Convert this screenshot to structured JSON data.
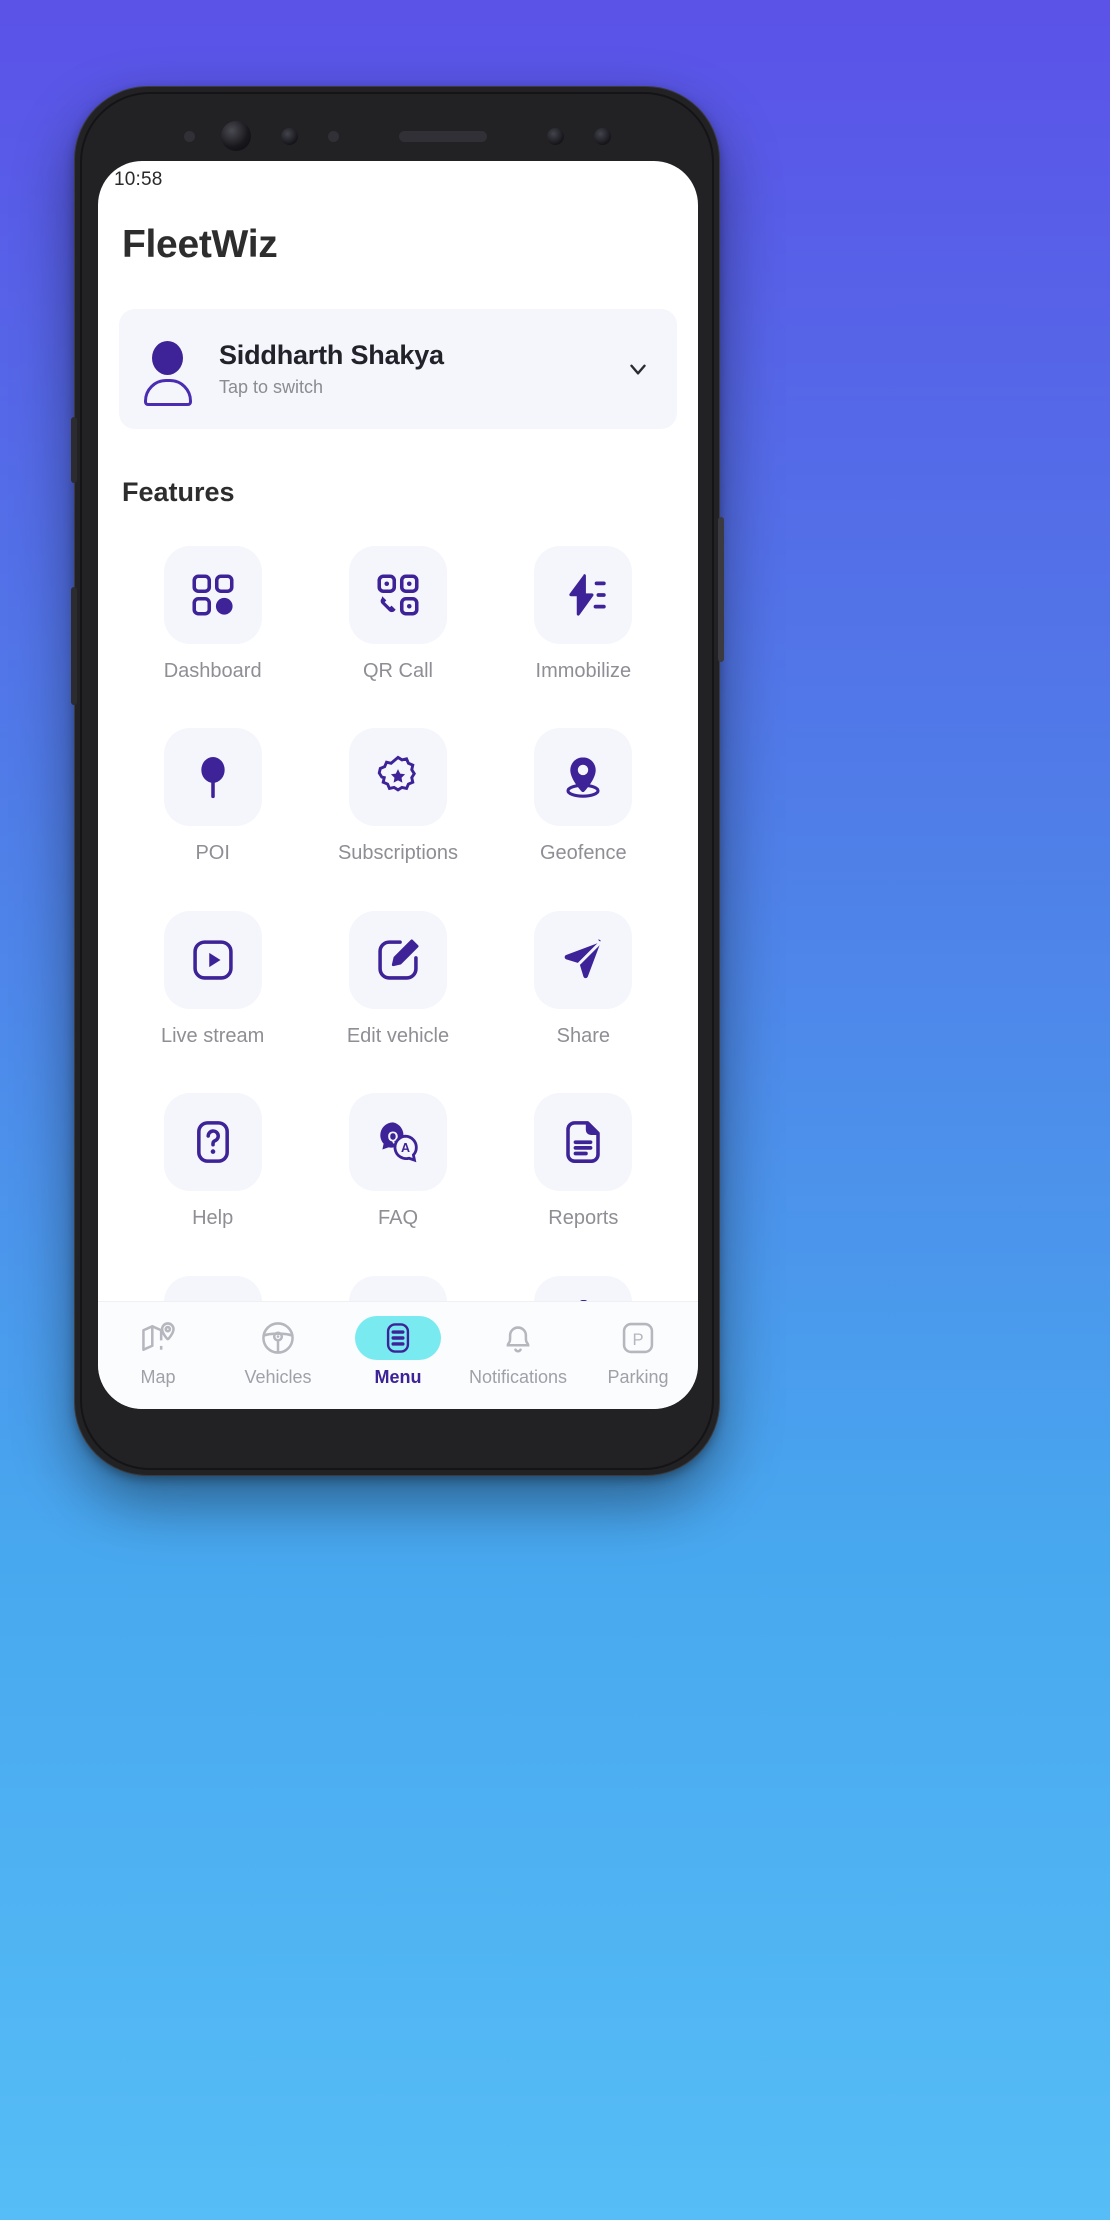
{
  "statusbar": {
    "time": "10:58"
  },
  "app": {
    "title": "FleetWiz",
    "accent": "#3d2397",
    "tile_bg": "#f4f6fb",
    "active_pill": "#79eaf0"
  },
  "profile": {
    "name": "Siddharth Shakya",
    "subtitle": "Tap to switch",
    "avatar_icon": "person-icon",
    "chevron_icon": "chevron-down-icon"
  },
  "features": {
    "heading": "Features",
    "items": [
      {
        "label": "Dashboard",
        "icon": "grid-dashboard-icon"
      },
      {
        "label": "QR Call",
        "icon": "qr-phone-icon"
      },
      {
        "label": "Immobilize",
        "icon": "lightning-bolt-icon"
      },
      {
        "label": "POI",
        "icon": "pin-balloon-icon"
      },
      {
        "label": "Subscriptions",
        "icon": "badge-star-icon"
      },
      {
        "label": "Geofence",
        "icon": "map-pin-base-icon"
      },
      {
        "label": "Live stream",
        "icon": "play-square-icon"
      },
      {
        "label": "Edit vehicle",
        "icon": "pencil-square-icon"
      },
      {
        "label": "Share",
        "icon": "send-paperplane-icon"
      },
      {
        "label": "Help",
        "icon": "question-square-icon"
      },
      {
        "label": "FAQ",
        "icon": "qa-bubbles-icon"
      },
      {
        "label": "Reports",
        "icon": "document-lines-icon"
      },
      {
        "label": "",
        "icon": "pin-balloon-icon"
      },
      {
        "label": "",
        "icon": "pin-balloon-icon"
      },
      {
        "label": "",
        "icon": "gear-icon"
      }
    ]
  },
  "bottomnav": {
    "items": [
      {
        "label": "Map",
        "icon": "map-pin-icon",
        "active": false
      },
      {
        "label": "Vehicles",
        "icon": "steering-wheel-icon",
        "active": false
      },
      {
        "label": "Menu",
        "icon": "list-menu-icon",
        "active": true
      },
      {
        "label": "Notifications",
        "icon": "bell-icon",
        "active": false
      },
      {
        "label": "Parking",
        "icon": "parking-p-icon",
        "active": false
      }
    ]
  }
}
